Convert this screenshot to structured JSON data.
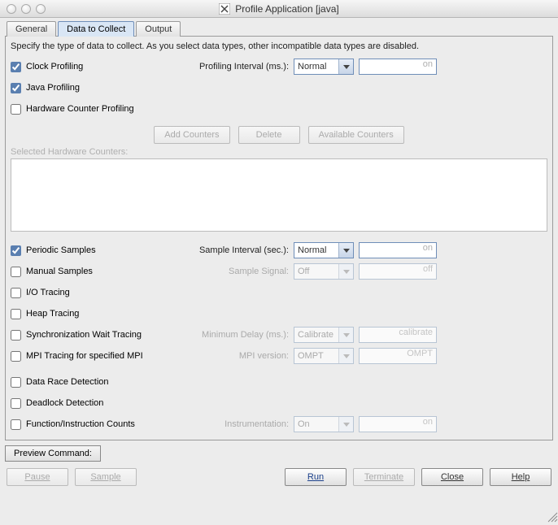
{
  "window": {
    "title": "Profile Application [java]"
  },
  "tabs": {
    "general": "General",
    "data": "Data to Collect",
    "output": "Output"
  },
  "desc": "Specify the type of data to collect.  As you select data types, other incompatible data types are disabled.",
  "items": {
    "clock": "Clock Profiling",
    "java": "Java Profiling",
    "hw": "Hardware Counter Profiling",
    "periodic": "Periodic Samples",
    "manual": "Manual Samples",
    "io": "I/O Tracing",
    "heap": "Heap Tracing",
    "sync": "Synchronization Wait Tracing",
    "mpi": "MPI Tracing for specified MPI",
    "race": "Data Race Detection",
    "deadlock": "Deadlock Detection",
    "funcinst": "Function/Instruction Counts"
  },
  "labels": {
    "profInterval": "Profiling Interval (ms.):",
    "sampleInterval": "Sample Interval (sec.):",
    "sampleSignal": "Sample Signal:",
    "minDelay": "Minimum Delay (ms.):",
    "mpiVersion": "MPI version:",
    "instrumentation": "Instrumentation:",
    "selectedHw": "Selected Hardware Counters:"
  },
  "selects": {
    "normal": "Normal",
    "off": "Off",
    "calibrate": "Calibrate",
    "ompt": "OMPT",
    "on": "On"
  },
  "ghosts": {
    "on": "on",
    "off": "off",
    "calibrate": "calibrate",
    "ompt": "OMPT"
  },
  "btns": {
    "addCounters": "Add Counters",
    "delete": "Delete",
    "availCounters": "Available Counters",
    "preview": "Preview Command:",
    "pause": "Pause",
    "sample": "Sample",
    "run": "Run",
    "terminate": "Terminate",
    "close": "Close",
    "help": "Help"
  }
}
